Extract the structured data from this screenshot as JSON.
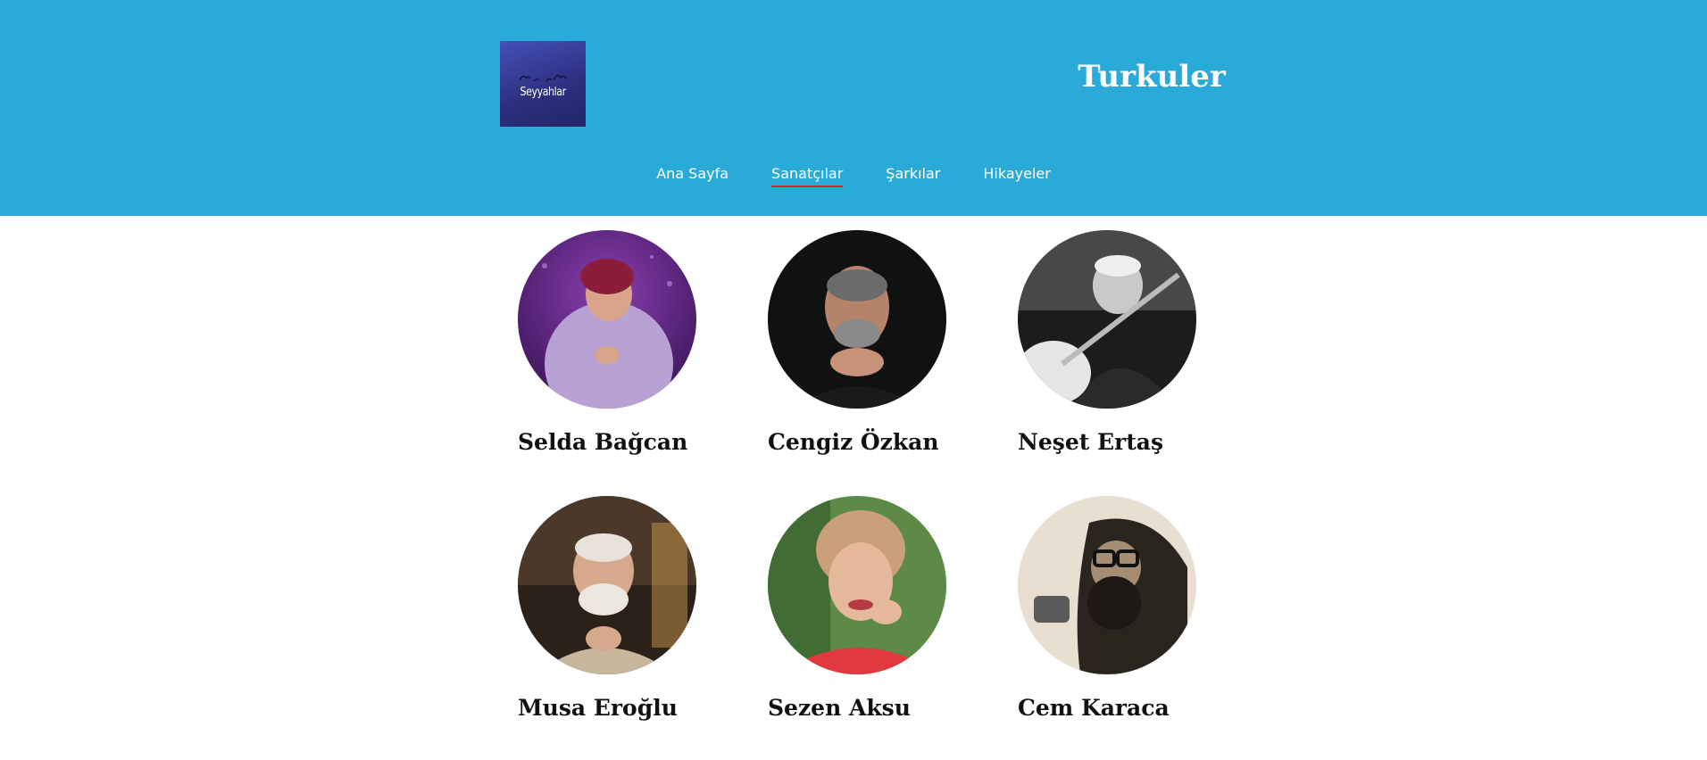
{
  "header": {
    "logo_text": "Seyyahlar",
    "site_title": "Turkuler",
    "background": "#2aaad9"
  },
  "nav": {
    "items": [
      {
        "label": "Ana Sayfa",
        "active": false
      },
      {
        "label": "Sanatçılar",
        "active": true
      },
      {
        "label": "Şarkılar",
        "active": false
      },
      {
        "label": "Hikayeler",
        "active": false
      }
    ],
    "active_underline_color": "#d6202c"
  },
  "artists": [
    {
      "name": "Selda Bağcan",
      "photo": "portrait-purple-stage"
    },
    {
      "name": "Cengiz Özkan",
      "photo": "portrait-dark-background"
    },
    {
      "name": "Neşet Ertaş",
      "photo": "portrait-black-white-baglama"
    },
    {
      "name": "Musa Eroğlu",
      "photo": "portrait-warm-interior"
    },
    {
      "name": "Sezen Aksu",
      "photo": "portrait-green-red"
    },
    {
      "name": "Cem Karaca",
      "photo": "portrait-sepia-microphone"
    }
  ]
}
